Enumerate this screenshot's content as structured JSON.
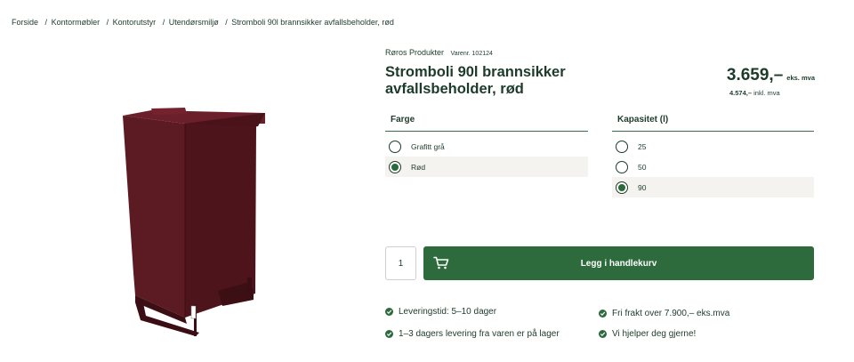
{
  "breadcrumb": {
    "items": [
      "Forside",
      "Kontormøbler",
      "Kontorutstyr",
      "Utendørsmiljø",
      "Stromboli 90l brannsikker avfallsbeholder, rød"
    ],
    "separator": "/"
  },
  "product": {
    "brand": "Røros Produkter",
    "sku": "Varenr. 102124",
    "title": "Stromboli 90l brannsikker avfallsbeholder, rød",
    "image_color": "#5c1a22"
  },
  "price": {
    "main": "3.659,–",
    "main_suffix": "eks. mva",
    "incl_value": "4.574,–",
    "incl_suffix": "inkl. mva"
  },
  "options": {
    "color": {
      "header": "Farge",
      "items": [
        {
          "label": "Grafitt grå",
          "selected": false
        },
        {
          "label": "Rød",
          "selected": true
        }
      ]
    },
    "capacity": {
      "header": "Kapasitet (l)",
      "items": [
        {
          "label": "25",
          "selected": false
        },
        {
          "label": "50",
          "selected": false
        },
        {
          "label": "90",
          "selected": true
        }
      ]
    }
  },
  "cart": {
    "quantity": "1",
    "button_label": "Legg i handlekurv",
    "icon": "cart-icon"
  },
  "usps": [
    "Leveringstid: 5–10 dager",
    "1–3 dagers levering fra varen er på lager",
    "Fri frakt over 7.900,– eks.mva",
    "Vi hjelper deg gjerne!"
  ],
  "colors": {
    "accent": "#2d6b3c",
    "text": "#1d3b2a",
    "selected_bg": "#f5f3ef"
  }
}
